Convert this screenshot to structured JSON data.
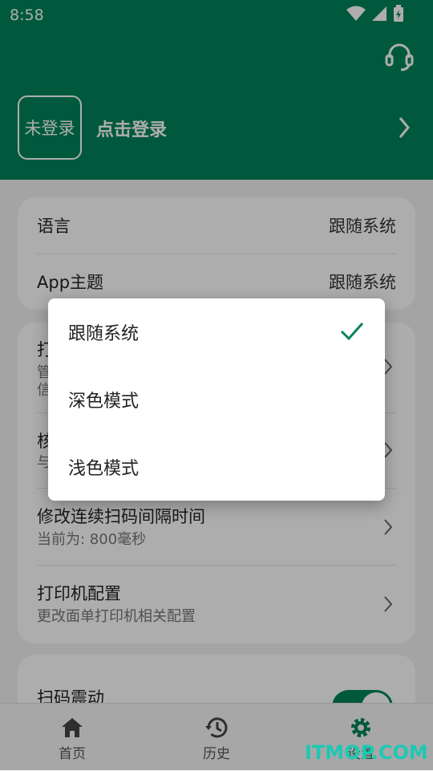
{
  "status_bar": {
    "time": "8:58"
  },
  "header": {
    "avatar_label": "未登录",
    "login_text": "点击登录"
  },
  "settings": {
    "card1": [
      {
        "title": "语言",
        "value": "跟随系统"
      },
      {
        "title": "App主题",
        "value": "跟随系统"
      }
    ],
    "card2": [
      {
        "title": "打",
        "subtitle1": "管",
        "subtitle2": "信"
      },
      {
        "title": "核",
        "subtitle": "与"
      },
      {
        "title": "修改连续扫码间隔时间",
        "subtitle": "当前为: 800毫秒"
      },
      {
        "title": "打印机配置",
        "subtitle": "更改面单打印机相关配置"
      }
    ],
    "card3": {
      "title": "扫码震动",
      "toggle_on": true
    }
  },
  "dialog": {
    "options": [
      {
        "label": "跟随系统",
        "selected": true
      },
      {
        "label": "深色模式",
        "selected": false
      },
      {
        "label": "浅色模式",
        "selected": false
      }
    ]
  },
  "bottom_nav": [
    {
      "label": "首页",
      "icon": "home-icon"
    },
    {
      "label": "历史",
      "icon": "history-icon"
    },
    {
      "label": "设置",
      "icon": "gear-icon",
      "active": true
    }
  ],
  "watermark": "ITMOP.COM",
  "colors": {
    "brand": "#01845b",
    "watermark": "#1ec8b4"
  }
}
